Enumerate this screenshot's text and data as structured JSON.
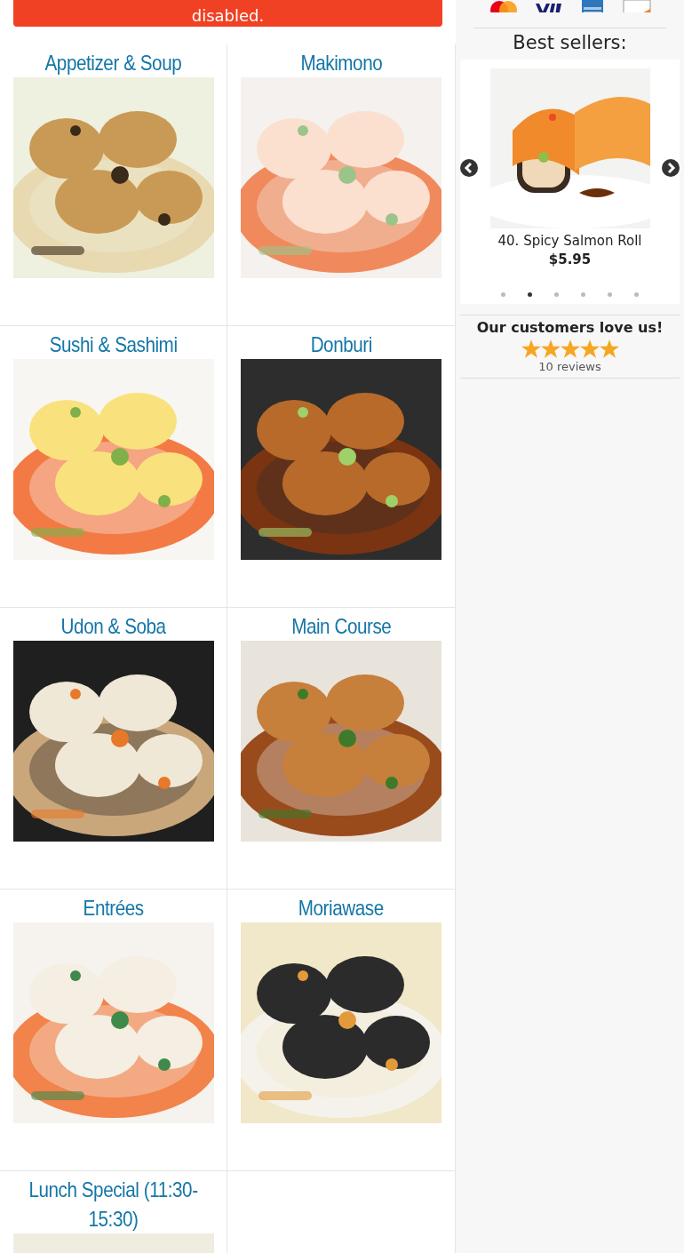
{
  "alert": {
    "text": "disabled."
  },
  "categories": [
    {
      "name": "Appetizer & Soup"
    },
    {
      "name": "Makimono"
    },
    {
      "name": "Sushi & Sashimi"
    },
    {
      "name": "Donburi"
    },
    {
      "name": "Udon & Soba"
    },
    {
      "name": "Main Course"
    },
    {
      "name": "Entrées"
    },
    {
      "name": "Moriawase"
    },
    {
      "name": "Lunch Special (11:30-15:30)"
    }
  ],
  "sidebar": {
    "best_sellers": {
      "title": "Best sellers:",
      "item": {
        "name": "40. Spicy Salmon Roll",
        "price": "$5.95"
      },
      "dots": [
        {
          "selected": false
        },
        {
          "selected": true
        },
        {
          "selected": false
        },
        {
          "selected": false
        },
        {
          "selected": false
        },
        {
          "selected": false
        }
      ]
    },
    "reviews": {
      "title": "Our customers love us!",
      "stars": 5,
      "count": "10 reviews"
    }
  }
}
